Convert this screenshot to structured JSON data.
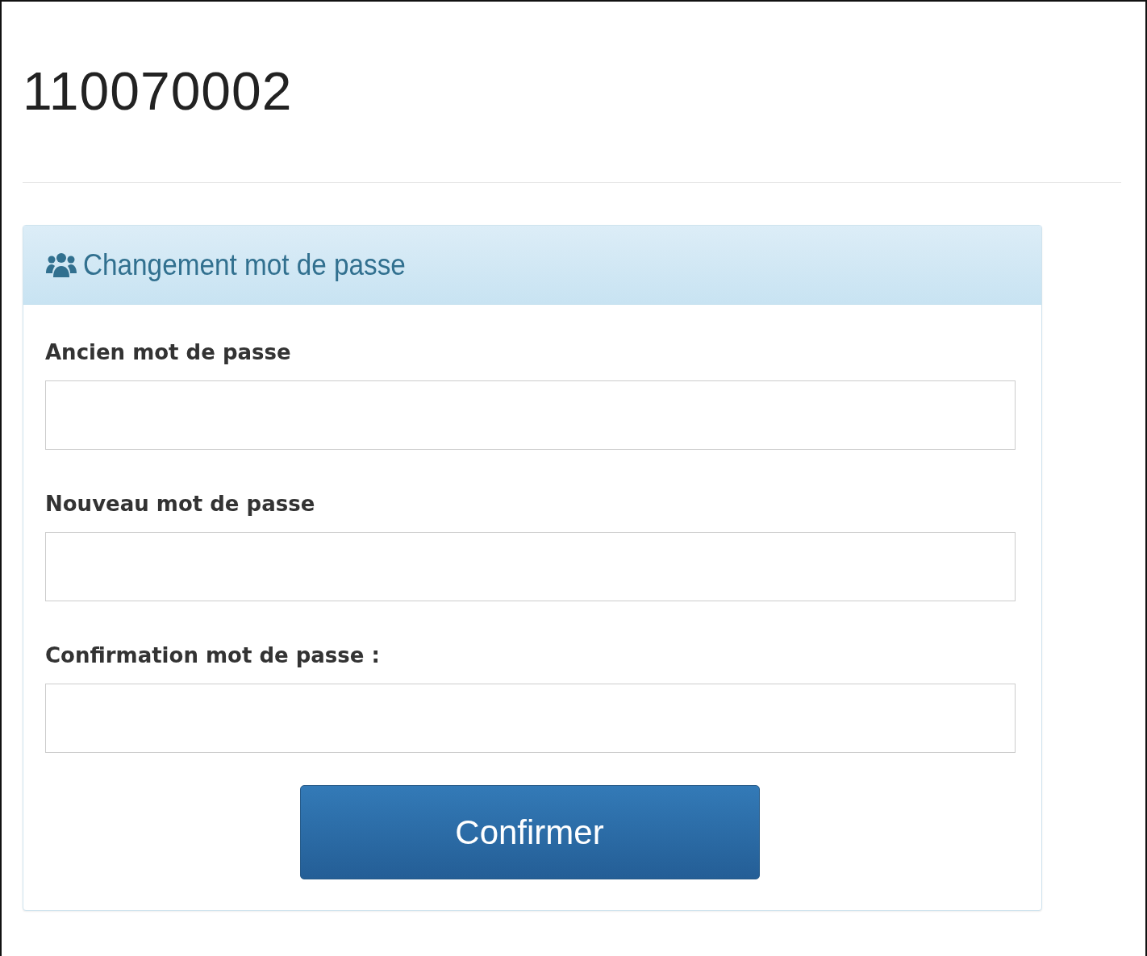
{
  "page_title": "110070002",
  "panel": {
    "title": "Changement mot de passe",
    "fields": [
      {
        "label": "Ancien mot de passe"
      },
      {
        "label": "Nouveau mot de passe"
      },
      {
        "label": "Confirmation mot de passe :"
      }
    ],
    "submit": "Confirmer"
  }
}
